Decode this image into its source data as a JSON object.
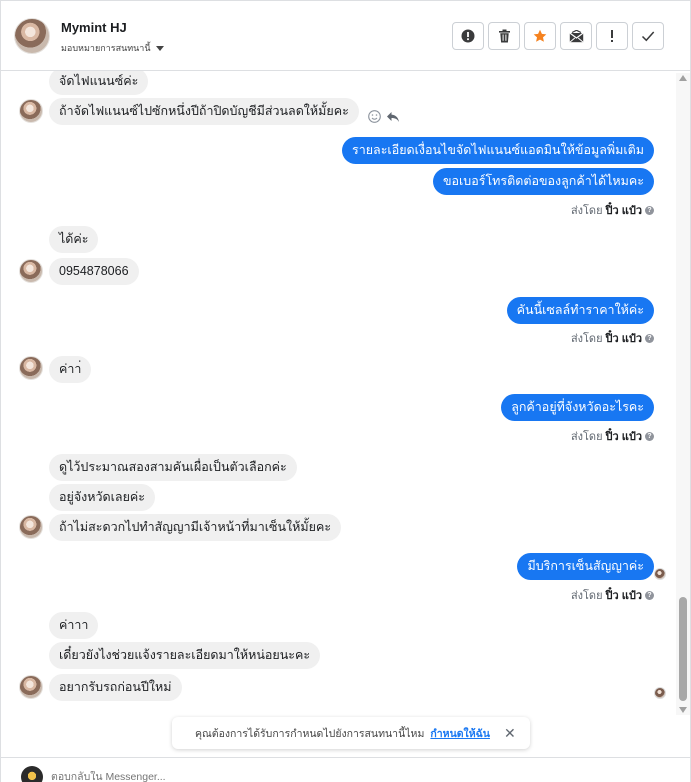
{
  "header": {
    "name": "Mymint HJ",
    "assign_label": "มอบหมายการสนทนานี้"
  },
  "messages": [
    {
      "text": "จัดไฟแนนซ์ค่ะ"
    },
    {
      "text": "ถ้าจัดไฟแนนซ์ไปซักหนึ่งปีถ้าปิดบัญชีมีส่วนลดให้มั้ยคะ"
    },
    {
      "text": "รายละเอียดเงื่อนไขจัดไฟแนนซ์แอดมินให้ข้อมูลพิ่มเติม"
    },
    {
      "text": "ขอเบอร์โทรติดต่อของลูกค้าได้ไหมคะ"
    },
    {
      "text": "ได้ค่ะ"
    },
    {
      "text": "0954878066"
    },
    {
      "text": "คันนี้เซลล์ทำราคาให้ค่ะ"
    },
    {
      "text": "ค่าา่"
    },
    {
      "text": "ลูกค้าอยู่ที่จังหวัดอะไรคะ"
    },
    {
      "text": "ดูไว้ประมาณสองสามคันเผื่อเป็นตัวเลือกค่ะ"
    },
    {
      "text": "อยู่จังหวัดเลยค่ะ"
    },
    {
      "text": "ถ้าไม่สะดวกไปทำสัญญามีเจ้าหน้าที่มาเซ็นให้มั้ยคะ"
    },
    {
      "text": "มีบริการเซ็นสัญญาค่ะ"
    },
    {
      "text": "ค่าาา"
    },
    {
      "text": "เดี๋ยวยังไงช่วยแจ้งรายละเอียดมาให้หน่อยนะคะ"
    },
    {
      "text": "อยากรับรถก่อนปีใหม่"
    }
  ],
  "sent_by": {
    "prefix": "ส่งโดย",
    "agent": "ปิ๋ว แป๋ว",
    "help": "?"
  },
  "banner": {
    "text": "คุณต้องการได้รับการกำหนดไปยังการสนทนานี้ไหม",
    "link": "กำหนดให้ฉัน",
    "close": "✕"
  },
  "composer": {
    "placeholder": "ตอบกลับใน Messenger..."
  },
  "colors": {
    "outgoing": "#1877f2",
    "incoming": "#f0f0f0",
    "star": "#f5821f"
  }
}
